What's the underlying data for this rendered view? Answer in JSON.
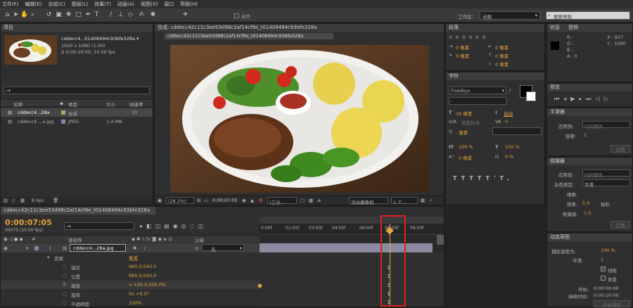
{
  "menu": [
    "文件(F)",
    "编辑(E)",
    "合成(C)",
    "图层(L)",
    "效果(T)",
    "动画(A)",
    "视图(V)",
    "窗口",
    "帮助(H)"
  ],
  "toolbar": {
    "align_label": "对齐",
    "workspace_label": "工作区：",
    "workspace_value": "动画",
    "search_placeholder": "搜索帮助"
  },
  "project": {
    "title": "项目",
    "item_name": "cddecc4...01408494c93bfe328a ▾",
    "item_res": "1920 x 1080 (1.00)",
    "item_dur": "Δ 0:00:10:00, 10.00 fps",
    "col_name": "名称",
    "col_type": "类型",
    "col_size": "大小",
    "col_rate": "帧速率",
    "rows": [
      {
        "name": "cddecc4...28a",
        "type": "合成",
        "size": "",
        "rate": "10"
      },
      {
        "name": "cddecc4....a.jpg",
        "type": "JPEG",
        "size": "1.4 MB",
        "rate": ""
      }
    ],
    "bpc": "8 bpc"
  },
  "comp": {
    "title": "合成: cddecc42c11c3ee53d98c2af14cf9e_t01408494c93bfe328a",
    "tab": "cddecc42c11c3ee53d98c2af14cf9e_t01408494c93bfe328a",
    "zoom": "(28.2%)",
    "time": "0:00:07:05",
    "res": "(三分...",
    "camera": "活动摄像机",
    "views": "1 个..."
  },
  "align": {
    "title": "段落",
    "val1": "0 像素",
    "val2": "0 像素",
    "val3": "0 像素",
    "val4": "0 像素",
    "val5": "0 像素"
  },
  "character": {
    "title": "字符",
    "font": "Fixedsys",
    "size": "36 像素",
    "auto": "自动",
    "track": "度量标准",
    "track_val": "0",
    "leading": "- 像素",
    "scale_v": "100 %",
    "scale_h": "100 %",
    "baseline": "0 像素",
    "tsume": "0 %"
  },
  "info": {
    "title": "信息",
    "tab2": "音频",
    "r": "R :",
    "g": "G :",
    "b": "B :",
    "a": "A : 0",
    "x": "X : 917",
    "y": "Y : 1090"
  },
  "preview": {
    "title": "预览"
  },
  "smoother": {
    "title": "平滑器",
    "apply_to": "应用到:",
    "apply_val": "时间图表",
    "tolerance": "容差:",
    "tol_val": "1",
    "apply_btn": "应用"
  },
  "wiggler": {
    "title": "摇摆器",
    "apply_to": "应用到:",
    "apply_val": "时间图表",
    "noise_type": "杂色类型:",
    "noise_val": "平滑",
    "dimension": "维数:",
    "freq": "频率:",
    "freq_val": "5.0",
    "per_sec": "每秒",
    "magnitude": "数量级:",
    "mag_val": "1.0",
    "apply_btn": "应用"
  },
  "motion": {
    "title": "动态草图",
    "speed": "捕捉速度为:",
    "speed_val": "100 %",
    "smooth": "平滑:",
    "smooth_val": "1",
    "wireframe": "线框",
    "background": "背景",
    "start": "开始:",
    "start_val": "0:00:00:00",
    "duration": "持续时间:",
    "duration_val": "0:00:10:00",
    "capture_btn": "开始捕捉"
  },
  "timeline": {
    "tab": "cddecc42c11c3ee53d98c2af14cf9e_t01408494c93bfe328a",
    "time": "0:00:07:05",
    "frames": "00075 (10.00 fps)",
    "col_source": "源名称",
    "col_parent": "父级",
    "parent_val": "无",
    "layer_num": "1",
    "layer_name": "cddecc4...28a.jpg",
    "transform": "变换",
    "reset": "重置",
    "props": [
      {
        "name": "锚点",
        "value": "960.0,540.0"
      },
      {
        "name": "位置",
        "value": "960.0,540.0"
      },
      {
        "name": "缩放",
        "value": "∞ 100.0,100.0%"
      },
      {
        "name": "旋转",
        "value": "0x +0.0°"
      },
      {
        "name": "不透明度",
        "value": "100%"
      }
    ],
    "ruler": [
      "0:00f",
      "01:05f",
      "03:00f",
      "04:05f",
      "06:00f",
      "08:05f",
      "09:00f"
    ]
  },
  "colors": {
    "accent": "#e4a23c",
    "highlight": "#e02020",
    "bg": "#232323"
  }
}
